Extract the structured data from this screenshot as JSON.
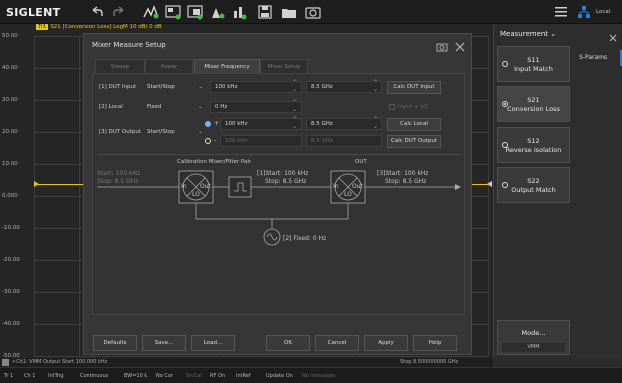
{
  "toolbar": {
    "logo": "SIGLENT",
    "local_label": "Local"
  },
  "trace": {
    "badge": "Tr1",
    "title": "S21 [Conversion Loss] LogM 10 dB/ 0 dB"
  },
  "chart": {
    "y_labels": [
      "50.00",
      "40.00",
      "30.00",
      "20.00",
      "10.00",
      "0.000",
      "-10.00",
      "-20.00",
      "-30.00",
      "-40.00",
      "-50.00"
    ]
  },
  "dialog": {
    "title": "Mixer Measure Setup",
    "tabs": [
      "Sweep",
      "Power",
      "Mixer Frequency",
      "Mixer Setup"
    ],
    "rows": {
      "dut_input": {
        "label": "[1] DUT Input",
        "mode": "Start/Stop",
        "start": "100 kHz",
        "stop": "8.5 GHz",
        "button": "Calc DUT Input"
      },
      "local": {
        "label": "[2] Local",
        "mode": "Fixed",
        "value": "0 Hz",
        "checkbox": "Input + LO"
      },
      "dut_output": {
        "label": "[3] DUT Output",
        "mode": "Start/Stop",
        "plus_sign": "+",
        "minus_sign": "-",
        "start1": "100 kHz",
        "stop1": "8.5 GHz",
        "start2": "100 kHz",
        "stop2": "8.5 GHz",
        "button1": "Calc Local",
        "button2": "Calc DUT Output"
      }
    },
    "diagram": {
      "cal_label": "Calibration Mixer/Filter Pair",
      "out_label": "OUT",
      "left_start": "Start: 100 kHz",
      "left_stop": "Stop: 8.5 GHz",
      "mid_start": "[1]Start: 100 kHz",
      "mid_stop": "Stop: 8.5 GHz",
      "right_start": "[3]Start: 100 kHz",
      "right_stop": "Stop: 8.5 GHz",
      "in": "In",
      "out": "Out",
      "lo": "LO",
      "lo_fixed": "[2] Fixed: 0 Hz"
    },
    "buttons": {
      "defaults": "Defaults",
      "save": "Save...",
      "load": "Load...",
      "ok": "OK",
      "cancel": "Cancel",
      "apply": "Apply",
      "help": "Help"
    }
  },
  "right_panel": {
    "title": "Measurement",
    "side_tab": "S-Params",
    "items": [
      {
        "name": "S11",
        "desc": "Input Match",
        "selected": false
      },
      {
        "name": "S21",
        "desc": "Conversion Loss",
        "selected": true
      },
      {
        "name": "S12",
        "desc": "Reverse Isolation",
        "selected": false
      },
      {
        "name": "S22",
        "desc": "Output Match",
        "selected": false
      }
    ],
    "mode_button": "Mode...",
    "mode_value": "VMM"
  },
  "infobar": {
    "left": ">Ch1: VMM Output Start 100.000 kHz",
    "right": "Stop 8.500000000 GHz"
  },
  "statusbar": [
    "Tr 1",
    "Ch 1",
    "IntTrig",
    "Continuous",
    "BW=10 k",
    "No Cor",
    "SrcCal",
    "RF On",
    "IntRef",
    "Update On",
    "No messages"
  ]
}
